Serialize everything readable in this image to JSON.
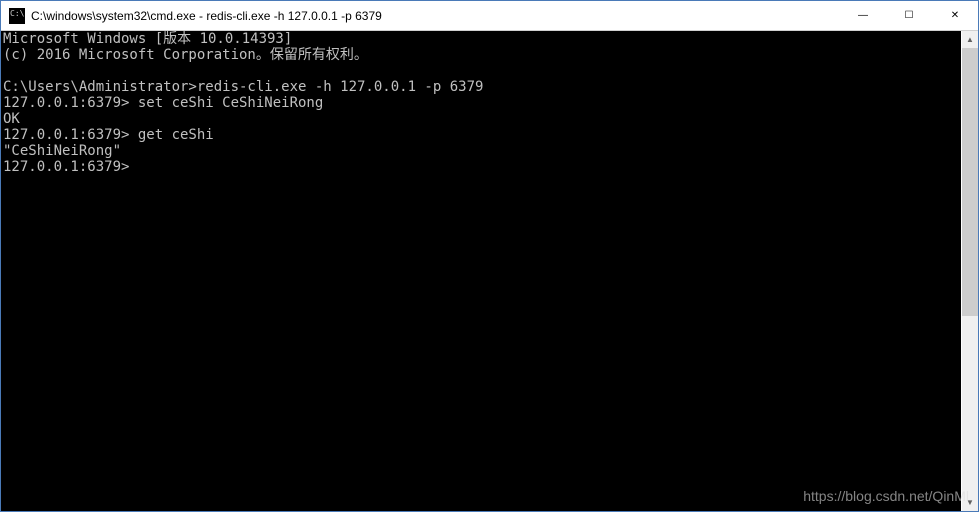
{
  "window": {
    "title": "C:\\windows\\system32\\cmd.exe - redis-cli.exe  -h 127.0.0.1 -p 6379"
  },
  "terminal": {
    "lines": [
      "Microsoft Windows [版本 10.0.14393]",
      "(c) 2016 Microsoft Corporation。保留所有权利。",
      "",
      "C:\\Users\\Administrator>redis-cli.exe -h 127.0.0.1 -p 6379",
      "127.0.0.1:6379> set ceShi CeShiNeiRong",
      "OK",
      "127.0.0.1:6379> get ceShi",
      "\"CeShiNeiRong\"",
      "127.0.0.1:6379>"
    ]
  },
  "watermark": "https://blog.csdn.net/QinMl",
  "controls": {
    "minimize": "—",
    "maximize": "☐",
    "close": "✕",
    "scroll_up": "▲",
    "scroll_down": "▼"
  }
}
